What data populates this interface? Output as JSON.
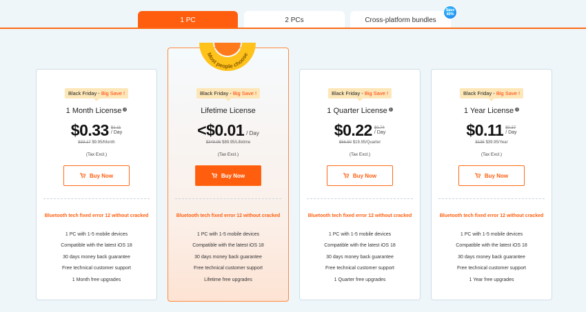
{
  "tabs": [
    {
      "label": "1 PC",
      "active": true
    },
    {
      "label": "2 PCs",
      "active": false
    },
    {
      "label": "Cross-platform bundles",
      "active": false
    }
  ],
  "save_badge": {
    "line1": "Save",
    "line2": "40%"
  },
  "ribbon": {
    "text": "Most people choose"
  },
  "colors": {
    "accent": "#ff5e0e",
    "badge_bg": "#fde7b8",
    "page_bg": "#eef6fa"
  },
  "cards": [
    {
      "badge_prefix": "Black Friday - ",
      "badge_highlight": "Big Save !",
      "title": "1 Month License",
      "price": "$0.33",
      "old_per_day": "$1.11",
      "per_day": "/ Day",
      "old_price": "$33.17",
      "period_price": "$9.95/Month",
      "tax": "(Tax Excl.)",
      "buy_label": "Buy Now",
      "feature_head": "Bluetooth tech fixed error 12 without cracked",
      "features": [
        "1 PC with 1-5 mobile devices",
        "Compatible with the latest iOS 18",
        "30 days money back guarantee",
        "Free technical customer support",
        "1 Month free upgrades"
      ]
    },
    {
      "badge_prefix": "Black Friday - ",
      "badge_highlight": "Big Save !",
      "title": "Lifetime License",
      "price": "<$0.01",
      "old_per_day": "",
      "per_day": "/ Day",
      "old_price": "$349.95",
      "period_price": "$89.95/Lifetime",
      "tax": "(Tax Excl.)",
      "buy_label": "Buy Now",
      "feature_head": "Bluetooth tech fixed error 12 without cracked",
      "features": [
        "1 PC with 1-5 mobile devices",
        "Compatible with the latest iOS 18",
        "30 days money back guarantee",
        "Free technical customer support",
        "Lifetime free upgrades"
      ]
    },
    {
      "badge_prefix": "Black Friday - ",
      "badge_highlight": "Big Save !",
      "title": "1 Quarter License",
      "price": "$0.22",
      "old_per_day": "$0.74",
      "per_day": "/ Day",
      "old_price": "$66.50",
      "period_price": "$19.95/Quarter",
      "tax": "(Tax Excl.)",
      "buy_label": "Buy Now",
      "feature_head": "Bluetooth tech fixed error 12 without cracked",
      "features": [
        "1 PC with 1-5 mobile devices",
        "Compatible with the latest iOS 18",
        "30 days money back guarantee",
        "Free technical customer support",
        "1 Quarter free upgrades"
      ]
    },
    {
      "badge_prefix": "Black Friday - ",
      "badge_highlight": "Big Save !",
      "title": "1 Year License",
      "price": "$0.11",
      "old_per_day": "$0.37",
      "per_day": "/ Day",
      "old_price": "$135",
      "period_price": "$39.95/Year",
      "tax": "(Tax Excl.)",
      "buy_label": "Buy Now",
      "feature_head": "Bluetooth tech fixed error 12 without cracked",
      "features": [
        "1 PC with 1-5 mobile devices",
        "Compatible with the latest iOS 18",
        "30 days money back guarantee",
        "Free technical customer support",
        "1 Year free upgrades"
      ]
    }
  ]
}
